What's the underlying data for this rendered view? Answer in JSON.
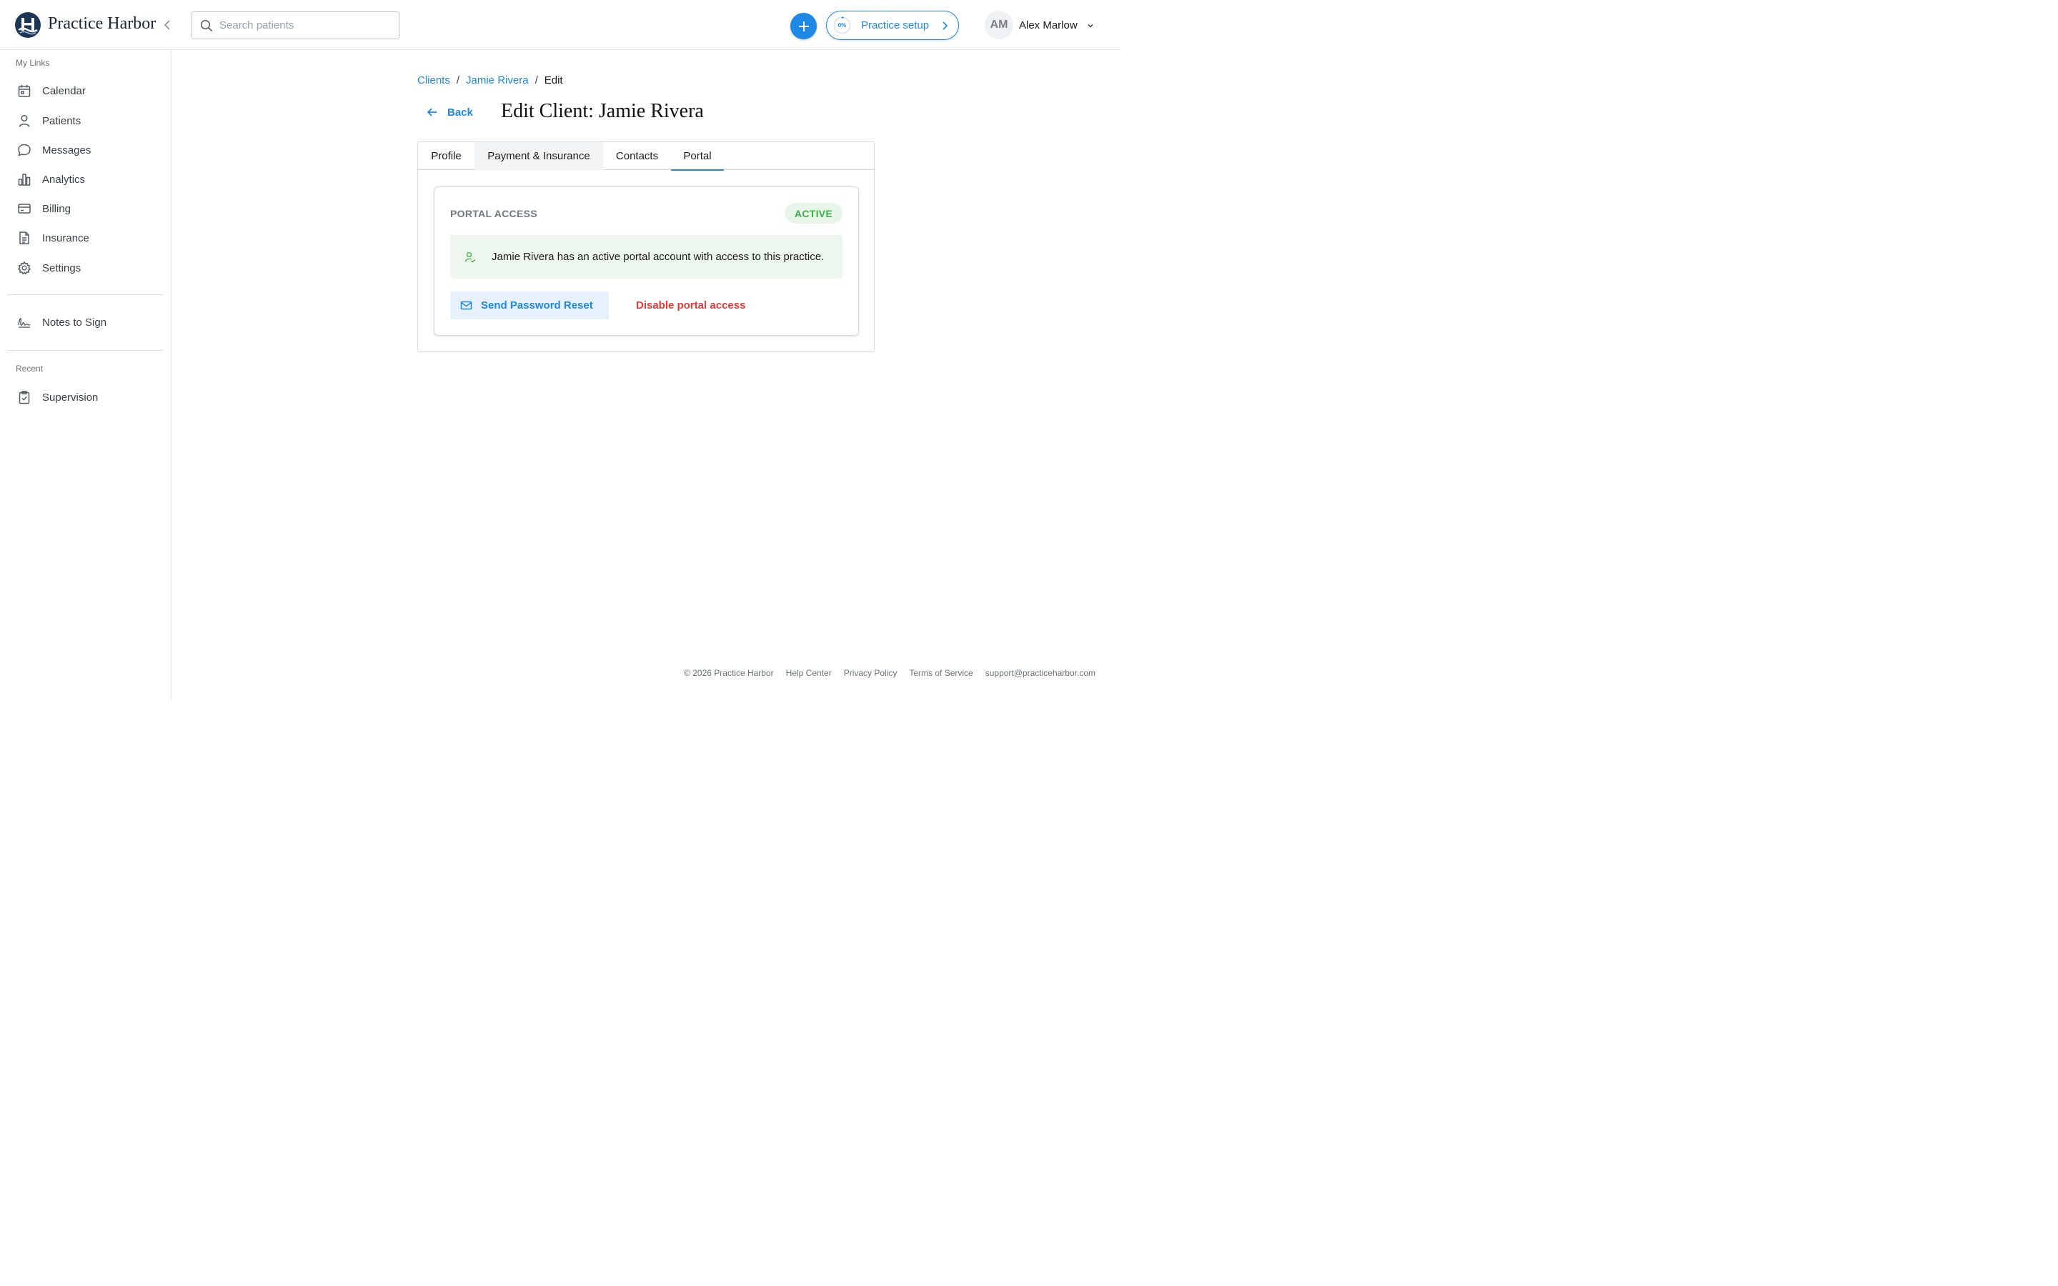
{
  "header": {
    "brand": "Practice Harbor",
    "search_placeholder": "Search patients",
    "setup_percent": "0%",
    "setup_progress": 0,
    "setup_label": "Practice setup",
    "avatar_initials": "AM",
    "user_name": "Alex Marlow"
  },
  "sidebar": {
    "my_links_heading": "My Links",
    "items": [
      {
        "label": "Calendar",
        "icon": "calendar-icon"
      },
      {
        "label": "Patients",
        "icon": "user-icon"
      },
      {
        "label": "Messages",
        "icon": "chat-bubble-icon"
      },
      {
        "label": "Analytics",
        "icon": "bar-chart-icon"
      },
      {
        "label": "Billing",
        "icon": "credit-card-icon"
      },
      {
        "label": "Insurance",
        "icon": "document-icon"
      },
      {
        "label": "Settings",
        "icon": "gear-icon"
      }
    ],
    "notes_item": {
      "label": "Notes to Sign",
      "icon": "signature-icon"
    },
    "recent_heading": "Recent",
    "recent_items": [
      {
        "label": "Supervision",
        "icon": "clipboard-check-icon"
      }
    ]
  },
  "main": {
    "breadcrumb": [
      "Clients",
      "Jamie Rivera",
      "Edit"
    ],
    "back_label": "Back",
    "title": "Edit Client: Jamie Rivera",
    "tabs": [
      {
        "label": "Profile"
      },
      {
        "label": "Payment & Insurance"
      },
      {
        "label": "Contacts"
      },
      {
        "label": "Portal",
        "active": true
      }
    ],
    "portal": {
      "title": "PORTAL ACCESS",
      "status": "ACTIVE",
      "notice": "Jamie Rivera has an active portal account with access to this practice.",
      "reset_label": "Send Password Reset",
      "disable_label": "Disable portal access"
    }
  },
  "footer": {
    "copyright": "© 2026 Practice Harbor",
    "links": [
      "Help Center",
      "Privacy Policy",
      "Terms of Service"
    ],
    "email": "support@practiceharbor.com"
  },
  "colors": {
    "accent": "#1e88e5",
    "success": "#3cb043",
    "danger": "#e53935",
    "brand_navy": "#1d3557"
  }
}
